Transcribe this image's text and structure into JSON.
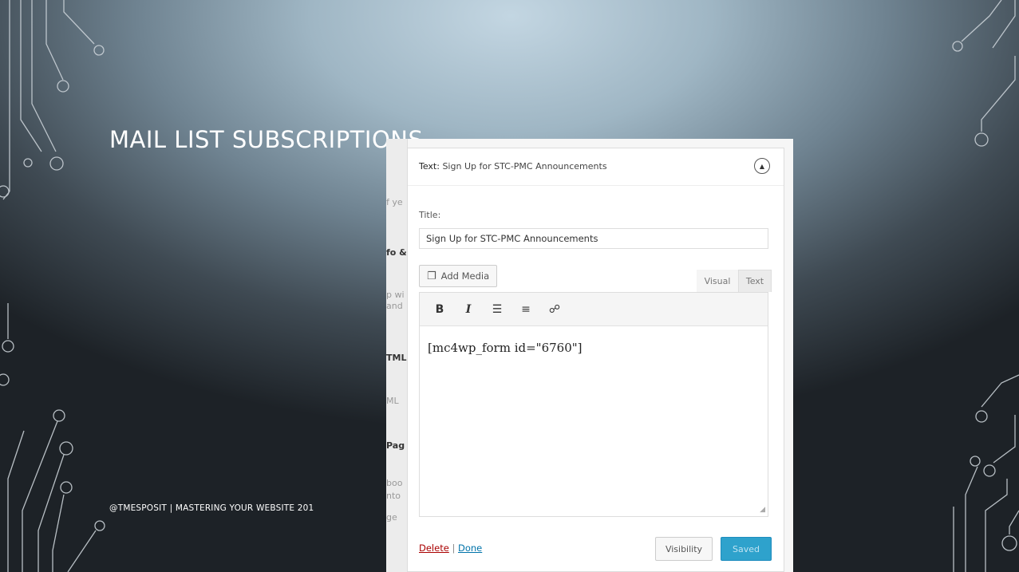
{
  "slide": {
    "title": "MAIL LIST SUBSCRIPTIONS",
    "footer": "@TMESPOSIT | MASTERING YOUR WEBSITE 201"
  },
  "background_fragments": [
    "f ye",
    "fo &",
    "p wi",
    "and",
    "TML",
    "ML",
    "Pag",
    "boo",
    "nto",
    "ge"
  ],
  "widget": {
    "header_prefix": "Text:",
    "header_title": "Sign Up for STC-PMC Announcements",
    "title_label": "Title:",
    "title_value": "Sign Up for STC-PMC Announcements",
    "add_media_label": "Add Media",
    "tabs": {
      "visual": "Visual",
      "text": "Text"
    },
    "editor_content": "[mc4wp_form id=\"6760\"]",
    "delete_label": "Delete",
    "separator": "|",
    "done_label": "Done",
    "visibility_label": "Visibility",
    "saved_label": "Saved"
  },
  "toolbar_icons": [
    "bold-icon",
    "italic-icon",
    "bulleted-list-icon",
    "numbered-list-icon",
    "link-icon"
  ],
  "colors": {
    "saved_button": "#2ea2cc",
    "delete_link": "#aa0000",
    "done_link": "#0073aa"
  }
}
